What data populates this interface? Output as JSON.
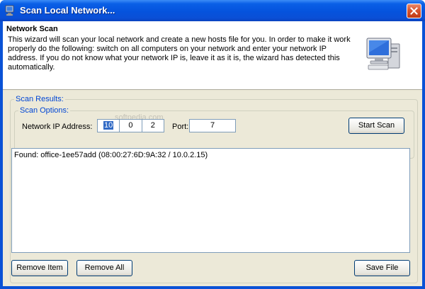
{
  "window": {
    "title": "Scan Local Network...",
    "close_symbol": "close-icon"
  },
  "header": {
    "title": "Network Scan",
    "description": "This wizard will scan your local network and create a new hosts file for you. In order to make it work properly do the following: switch on all computers on your network and enter your network IP address. If you do not know what your network IP is, leave it as it is, the wizard has detected this automatically.",
    "icon": "computer-icon"
  },
  "scan_results": {
    "group_label": "Scan Results:",
    "options": {
      "group_label": "Scan Options:",
      "ip_label": "Network IP Address:",
      "ip_segments": [
        "10",
        "0",
        "2"
      ],
      "port_label": "Port:",
      "port_value": "7",
      "start_button": "Start Scan"
    },
    "watermark": "softpedia.com",
    "items": [
      "Found: office-1ee57add (08:00:27:6D:9A:32 / 10.0.2.15)"
    ],
    "remove_item_button": "Remove Item",
    "remove_all_button": "Remove All",
    "save_file_button": "Save File"
  },
  "colors": {
    "titlebar": "#0553dd",
    "group_label": "#0046d5",
    "face": "#ece9d8",
    "selection": "#316ac5"
  }
}
